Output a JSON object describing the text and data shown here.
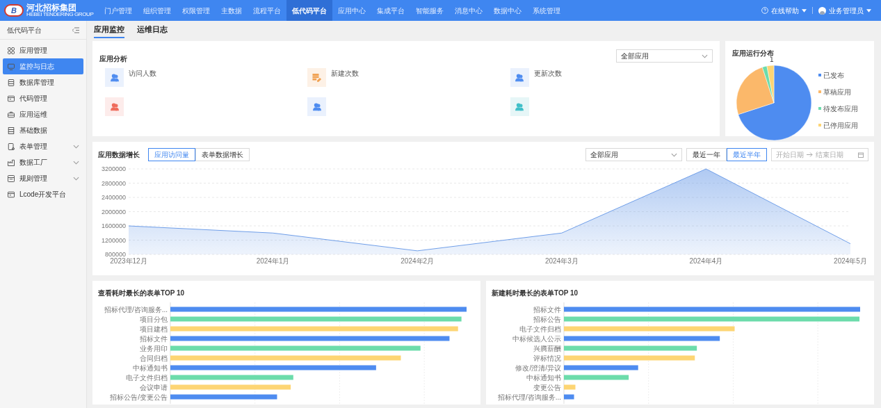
{
  "logo": {
    "name": "河北招标集团",
    "subtitle": "HEBEI TENDERING GROUP",
    "mark": "B"
  },
  "nav": [
    {
      "label": "门户管理",
      "selected": false
    },
    {
      "label": "组织管理",
      "selected": false
    },
    {
      "label": "权限管理",
      "selected": false
    },
    {
      "label": "主数据",
      "selected": false
    },
    {
      "label": "流程平台",
      "selected": false
    },
    {
      "label": "低代码平台",
      "selected": true
    },
    {
      "label": "应用中心",
      "selected": false
    },
    {
      "label": "集成平台",
      "selected": false
    },
    {
      "label": "智能服务",
      "selected": false
    },
    {
      "label": "消息中心",
      "selected": false
    },
    {
      "label": "数据中心",
      "selected": false
    },
    {
      "label": "系统管理",
      "selected": false
    }
  ],
  "help": "在线帮助",
  "user": "业务管理员",
  "sidebar": {
    "title": "低代码平台",
    "items": [
      {
        "label": "应用管理",
        "selected": false,
        "expandable": false
      },
      {
        "label": "监控与日志",
        "selected": true,
        "expandable": false
      },
      {
        "label": "数据库管理",
        "selected": false,
        "expandable": false
      },
      {
        "label": "代码管理",
        "selected": false,
        "expandable": false
      },
      {
        "label": "应用运维",
        "selected": false,
        "expandable": false
      },
      {
        "label": "基础数据",
        "selected": false,
        "expandable": false
      },
      {
        "label": "表单管理",
        "selected": false,
        "expandable": true
      },
      {
        "label": "数据工厂",
        "selected": false,
        "expandable": true
      },
      {
        "label": "规则管理",
        "selected": false,
        "expandable": true
      },
      {
        "label": "Lcode开发平台",
        "selected": false,
        "expandable": false
      }
    ]
  },
  "tabs": [
    {
      "label": "应用监控",
      "selected": true
    },
    {
      "label": "运维日志",
      "selected": false
    }
  ],
  "analysis": {
    "title": "应用分析",
    "filter": "全部应用",
    "stats": [
      {
        "label": "访问人数",
        "color": "#4e8cf0",
        "kind": "users"
      },
      {
        "label": "新建次数",
        "color": "#f0a050",
        "kind": "edit"
      },
      {
        "label": "更新次数",
        "color": "#4e8cf0",
        "kind": "users"
      },
      {
        "color": "#ef6b5b",
        "kind": "users"
      },
      {
        "color": "#4e8cf0",
        "kind": "users"
      },
      {
        "color": "#3fbfc8",
        "kind": "users"
      }
    ]
  },
  "distribution": {
    "title": "应用运行分布",
    "callout": "1",
    "legend": [
      {
        "label": "已发布",
        "color": "#4e8cf0"
      },
      {
        "label": "草稿应用",
        "color": "#fbb86a"
      },
      {
        "label": "待发布应用",
        "color": "#6cdcab"
      },
      {
        "label": "已停用应用",
        "color": "#fdd574"
      }
    ]
  },
  "growth": {
    "title": "应用数据增长",
    "modes": [
      {
        "label": "应用访问量",
        "selected": true
      },
      {
        "label": "表单数据增长",
        "selected": false
      }
    ],
    "filter": "全部应用",
    "ranges": [
      {
        "label": "最近一年",
        "selected": false
      },
      {
        "label": "最近半年",
        "selected": true
      }
    ],
    "start_placeholder": "开始日期",
    "end_placeholder": "结束日期",
    "chart_data": {
      "type": "area",
      "categories": [
        "2023年12月",
        "2024年1月",
        "2024年2月",
        "2024年3月",
        "2024年4月",
        "2024年5月"
      ],
      "values": [
        1600000,
        1400000,
        900000,
        1400000,
        3200000,
        1100000
      ],
      "ylim": [
        800000,
        3200000
      ],
      "grid": true,
      "yticks": [
        800000,
        1200000,
        1600000,
        2000000,
        2400000,
        2800000,
        3200000
      ]
    }
  },
  "top_view": {
    "title": "查看耗时最长的表单TOP 10",
    "forms": [
      "招标代理/咨询服务...",
      "项目分包",
      "项目建档",
      "招标文件",
      "业务用印",
      "合同归档",
      "中标通知书",
      "电子文件归档",
      "会议申请",
      "招标公告/变更公告"
    ]
  },
  "top_create": {
    "title": "新建耗时最长的表单TOP 10",
    "forms": [
      "招标文件",
      "招标公告",
      "电子文件归档",
      "中标候选人公示",
      "兴腾薪酬",
      "评标情况",
      "修改/澄清/异议",
      "中标通知书",
      "变更公告",
      "招标代理/咨询服务..."
    ]
  }
}
